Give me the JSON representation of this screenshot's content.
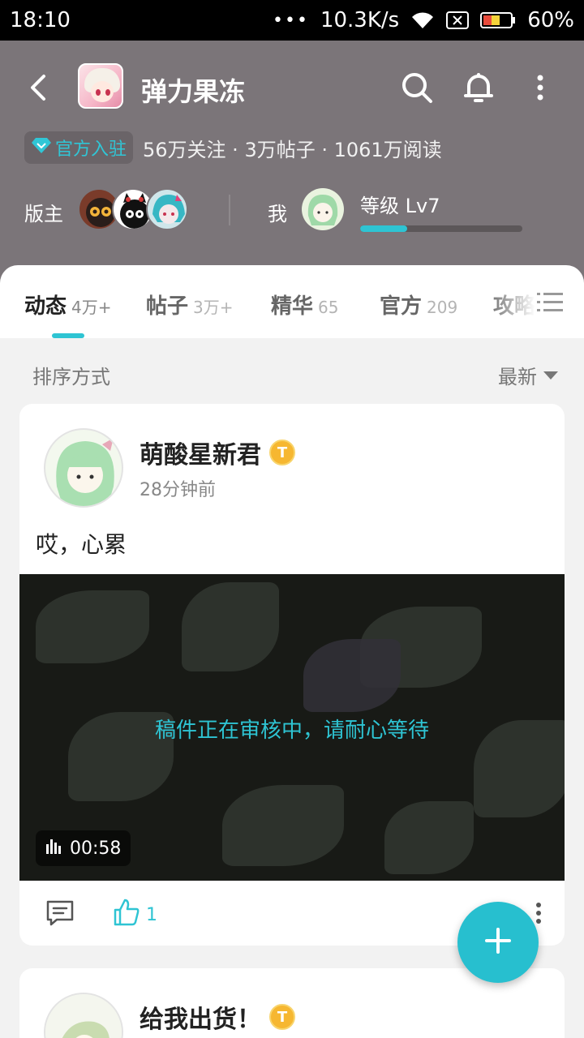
{
  "status_bar": {
    "time": "18:10",
    "dots": "•••",
    "network_speed": "10.3K/s",
    "battery": "60%"
  },
  "header": {
    "title": "弹力果冻",
    "badge": "官方入驻",
    "stats": "56万关注 · 3万帖子 · 1061万阅读",
    "moderator_label": "版主",
    "me_label": "我",
    "level_text": "等级 Lv7",
    "level_progress": 0.29,
    "accent_color": "#2ec4d3"
  },
  "tabs": [
    {
      "label": "动态",
      "count": "4万+"
    },
    {
      "label": "帖子",
      "count": "3万+"
    },
    {
      "label": "精华",
      "count": "65"
    },
    {
      "label": "官方",
      "count": "209"
    },
    {
      "label": "攻略",
      "count": ""
    }
  ],
  "sort": {
    "label": "排序方式",
    "value": "最新"
  },
  "posts": [
    {
      "author": "萌酸星新君",
      "badge": "T",
      "time": "28分钟前",
      "text": "哎，心累",
      "video": {
        "review_message": "稿件正在审核中，请耐心等待",
        "duration": "00:58"
      },
      "likes": "1"
    },
    {
      "author": "给我出货！",
      "badge": "T"
    }
  ],
  "icons": [
    "back-icon",
    "search-icon",
    "bell-icon",
    "more-vert-icon",
    "diamond-icon",
    "list-icon",
    "comment-icon",
    "thumbs-up-icon",
    "plus-icon"
  ]
}
